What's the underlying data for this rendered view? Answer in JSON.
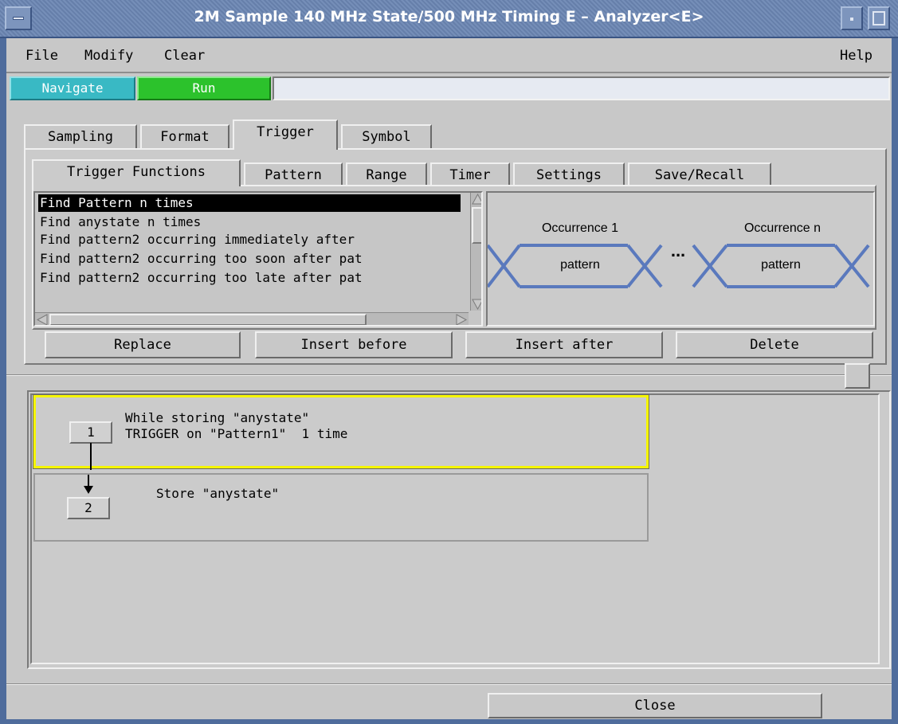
{
  "window": {
    "title": "2M Sample  140 MHz State/500 MHz Timing E – Analyzer<E>"
  },
  "menubar": {
    "file": "File",
    "modify": "Modify",
    "clear": "Clear",
    "help": "Help"
  },
  "toolbar": {
    "navigate": "Navigate",
    "run": "Run",
    "status": "",
    "navigate_color": "#39b9c4",
    "run_color": "#2cc22c"
  },
  "main_tabs": [
    "Sampling",
    "Format",
    "Trigger",
    "Symbol"
  ],
  "main_tab_selected": "Trigger",
  "sub_tabs": [
    "Trigger Functions",
    "Pattern",
    "Range",
    "Timer",
    "Settings",
    "Save/Recall"
  ],
  "sub_tab_selected": "Trigger Functions",
  "functions": {
    "items": [
      "Find Pattern n times",
      "Find anystate n times",
      "Find pattern2 occurring immediately after",
      "Find pattern2 occurring too soon after pat",
      "Find pattern2 occurring too late after pat"
    ],
    "selected": "Find Pattern n times"
  },
  "diagram": {
    "label_left": "Occurrence 1",
    "label_right": "Occurrence n",
    "box_left": "pattern",
    "box_right": "pattern",
    "ellipsis": "...",
    "line_color": "#5a79bd"
  },
  "actions": {
    "replace": "Replace",
    "insert_before": "Insert before",
    "insert_after": "Insert after",
    "delete": "Delete"
  },
  "sequence": {
    "steps": [
      {
        "number": "1",
        "line1": "While storing \"anystate\"",
        "line2": "TRIGGER on \"Pattern1\"  1 time"
      },
      {
        "number": "2",
        "line1": "Store \"anystate\"",
        "line2": ""
      }
    ],
    "active_color": "#f5f500"
  },
  "footer": {
    "close": "Close"
  }
}
